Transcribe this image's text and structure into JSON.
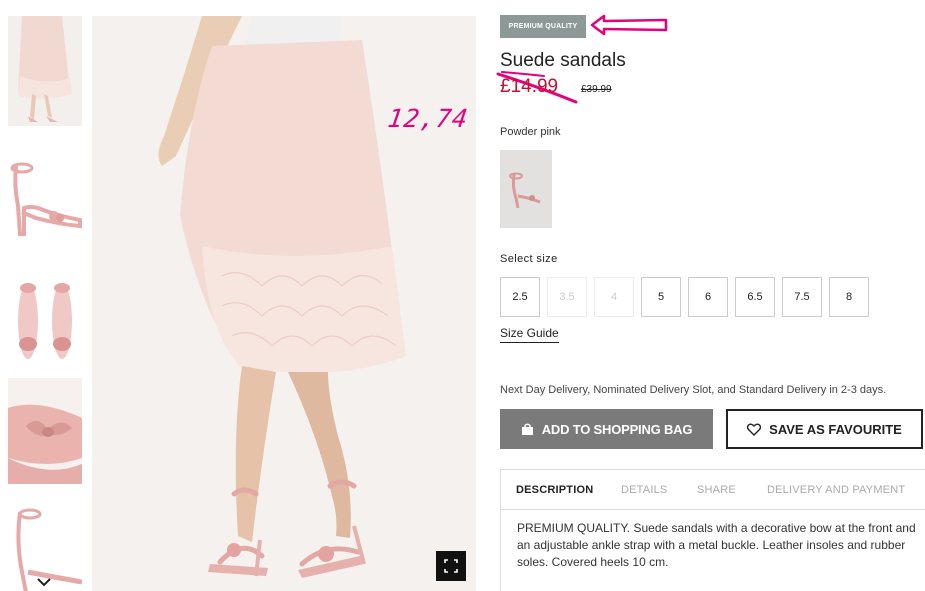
{
  "thumbnails": {
    "items": [
      {
        "alt": "skirt-model-thumb"
      },
      {
        "alt": "sandal-side-thumb"
      },
      {
        "alt": "sandal-pair-thumb"
      },
      {
        "alt": "sandal-bow-closeup-thumb"
      },
      {
        "alt": "sandal-side-partial-thumb"
      }
    ],
    "scroll_icon": "chevron-down-icon"
  },
  "product": {
    "badge": "PREMIUM QUALITY",
    "title": "Suede sandals",
    "price_sale": "£14.99",
    "price_original": "£39.99",
    "colour": "Powder pink",
    "size_label": "Select size",
    "sizes": [
      {
        "label": "2.5",
        "available": true
      },
      {
        "label": "3.5",
        "available": false
      },
      {
        "label": "4",
        "available": false
      },
      {
        "label": "5",
        "available": true
      },
      {
        "label": "6",
        "available": true
      },
      {
        "label": "6.5",
        "available": true
      },
      {
        "label": "7.5",
        "available": true
      },
      {
        "label": "8",
        "available": true
      }
    ],
    "size_guide": "Size Guide",
    "delivery_info": "Next Day Delivery, Nominated Delivery Slot, and Standard Delivery in 2-3 days.",
    "add_to_bag": "ADD TO SHOPPING BAG",
    "save_favourite": "SAVE AS FAVOURITE"
  },
  "tabs": [
    {
      "label": "DESCRIPTION",
      "active": true
    },
    {
      "label": "DETAILS",
      "active": false
    },
    {
      "label": "SHARE",
      "active": false
    },
    {
      "label": "DELIVERY AND PAYMENT",
      "active": false
    }
  ],
  "description": "PREMIUM QUALITY. Suede sandals with a decorative bow at the front and an adjustable ankle strap with a metal buckle. Leather insoles and rubber soles. Covered heels 10 cm.",
  "annotations": {
    "handwritten_price": "12,74"
  },
  "colors": {
    "sale_price": "#c8102e",
    "annotation": "#e6007e",
    "badge_bg": "#8c9996",
    "add_bag_bg": "#7a7a7a"
  }
}
